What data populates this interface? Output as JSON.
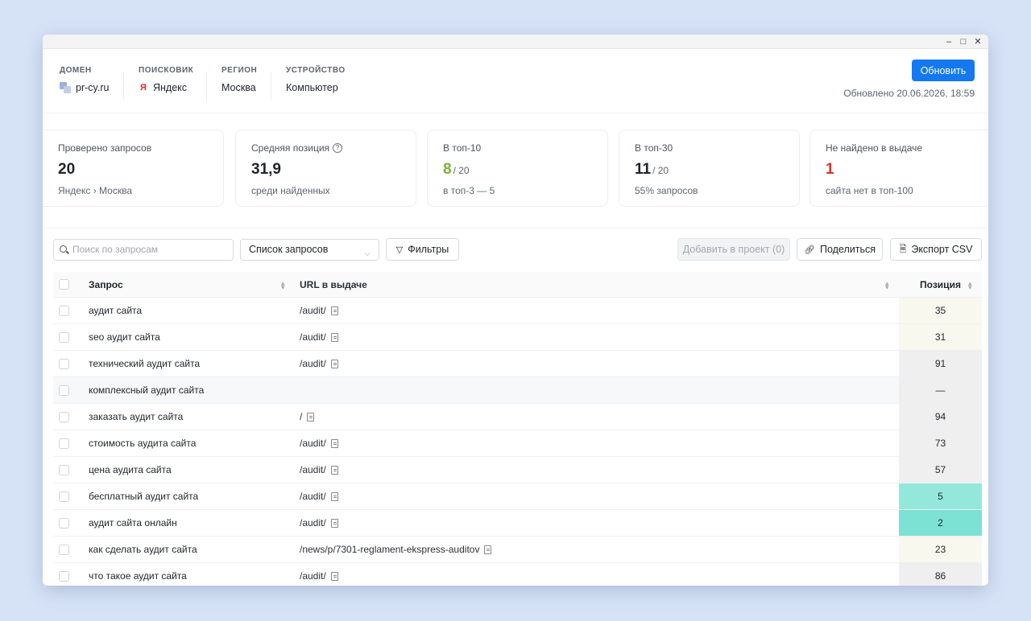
{
  "header": {
    "domain": {
      "label": "ДОМЕН",
      "value": "pr-cy.ru"
    },
    "engine": {
      "label": "ПОИСКОВИК",
      "value": "Яндекс",
      "icon_glyph": "Я"
    },
    "region": {
      "label": "РЕГИОН",
      "value": "Москва"
    },
    "device": {
      "label": "УСТРОЙСТВО",
      "value": "Компьютер"
    },
    "refresh_label": "Обновить",
    "updated_text": "Обновлено 20.06.2026, 18:59"
  },
  "cards": [
    {
      "label": "Проверено запросов",
      "value": "20",
      "sub": "",
      "note": "Яндекс › Москва",
      "color": "#1f2329"
    },
    {
      "label": "Средняя позиция",
      "value": "31,9",
      "sub": "",
      "note": "среди найденных",
      "color": "#1f2329"
    },
    {
      "label": "В топ-10",
      "value": "8",
      "sub": "/ 20",
      "note": "в топ-3 — 5",
      "color": "#79b13a"
    },
    {
      "label": "В топ-30",
      "value": "11",
      "sub": "/ 20",
      "note": "55% запросов",
      "color": "#1f2329"
    },
    {
      "label": "Не найдено в выдаче",
      "value": "1",
      "sub": "",
      "note": "сайта нет в топ-100",
      "color": "#d6332a"
    }
  ],
  "toolbar": {
    "search_placeholder": "Поиск по запросам",
    "list_select": "Список запросов",
    "filters_label": "Фильтры",
    "add_label": "Добавить в проект (0)",
    "share_label": "Поделиться",
    "export_label": "Экспорт CSV"
  },
  "table": {
    "headers": {
      "query": "Запрос",
      "url": "URL в выдаче",
      "position": "Позиция"
    },
    "rows": [
      {
        "query": "аудит сайта",
        "url": "/audit/",
        "position": "35",
        "bg": "#f8f8ef"
      },
      {
        "query": "seo аудит сайта",
        "url": "/audit/",
        "position": "31",
        "bg": "#f8f8ef"
      },
      {
        "query": "технический аудит сайта",
        "url": "/audit/",
        "position": "91",
        "bg": "#efeff0"
      },
      {
        "query": "комплексный аудит сайта",
        "url": "",
        "position": "—",
        "bg": "#efeff0"
      },
      {
        "query": "заказать аудит сайта",
        "url": "/",
        "position": "94",
        "bg": "#efeff0"
      },
      {
        "query": "стоимость аудита сайта",
        "url": "/audit/",
        "position": "73",
        "bg": "#efeff0"
      },
      {
        "query": "цена аудита сайта",
        "url": "/audit/",
        "position": "57",
        "bg": "#efeff0"
      },
      {
        "query": "бесплатный аудит сайта",
        "url": "/audit/",
        "position": "5",
        "bg": "#94e8db"
      },
      {
        "query": "аудит сайта онлайн",
        "url": "/audit/",
        "position": "2",
        "bg": "#7ce2d3"
      },
      {
        "query": "как сделать аудит сайта",
        "url": "/news/p/7301-reglament-ekspress-auditov",
        "position": "23",
        "bg": "#f8f8ef"
      },
      {
        "query": "что такое аудит сайта",
        "url": "/audit/",
        "position": "86",
        "bg": "#efeff0"
      }
    ]
  }
}
